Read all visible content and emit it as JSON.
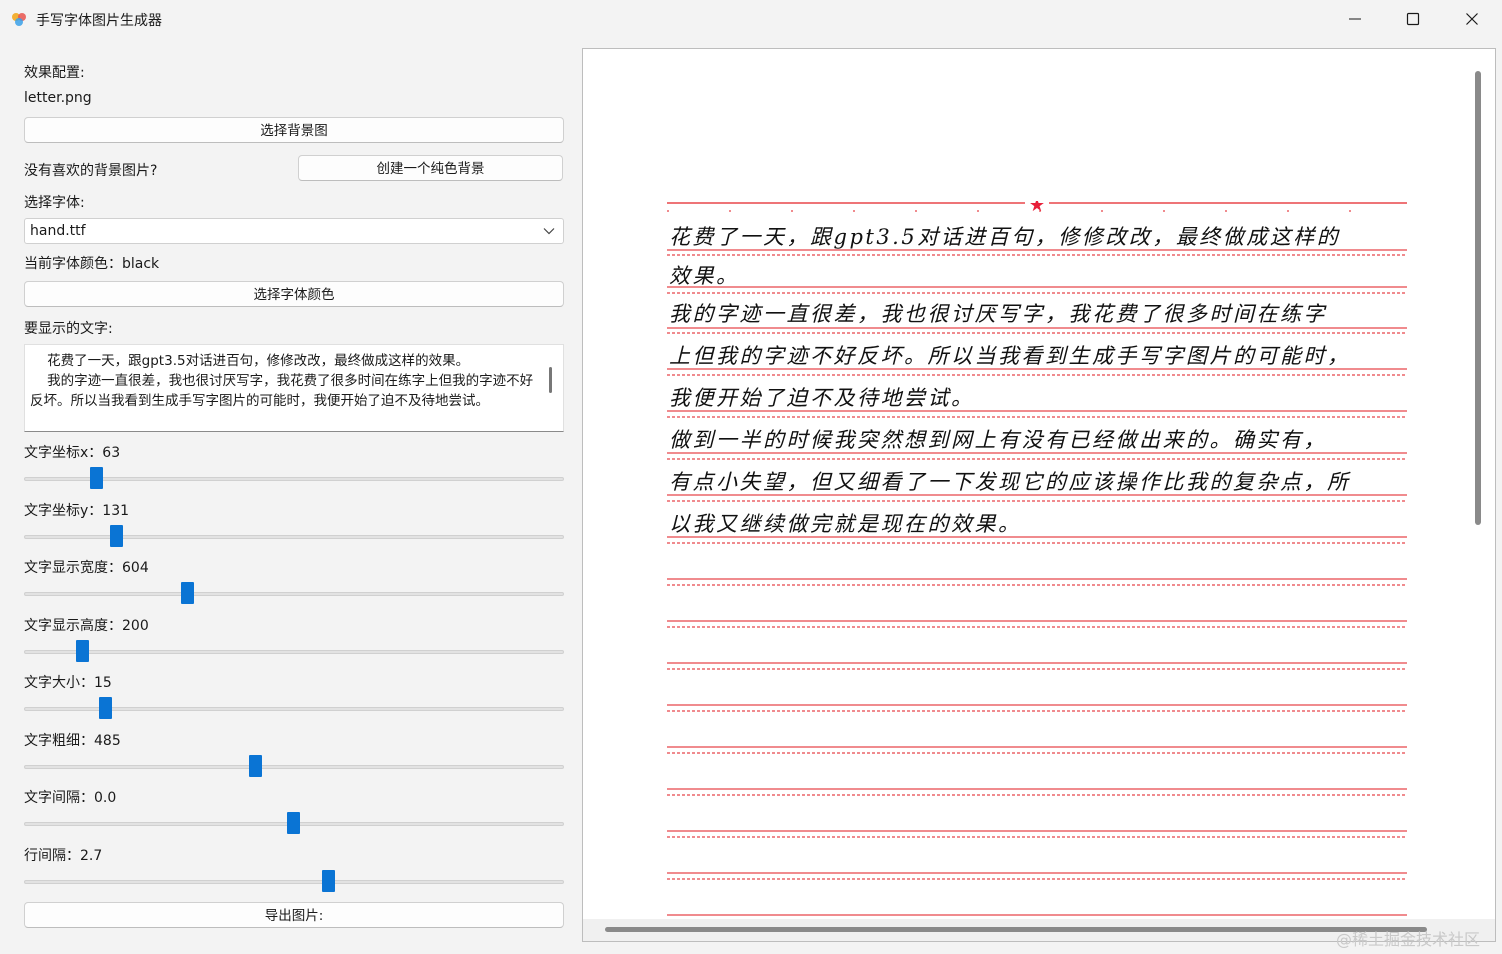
{
  "window": {
    "title": "手写字体图片生成器",
    "icon": "app-color-icon",
    "controls": [
      "minimize-icon",
      "maximize-icon",
      "close-icon"
    ]
  },
  "config": {
    "effect_label": "效果配置:",
    "background_file": "letter.png",
    "choose_background_button": "选择背景图",
    "no_favorite_label": "没有喜欢的背景图片?",
    "create_solid_button": "创建一个纯色背景",
    "choose_font_label": "选择字体:",
    "font_selected": "hand.ttf",
    "font_color_label": "当前字体颜色：black",
    "choose_font_color_button": "选择字体颜色",
    "text_label": "要显示的文字:",
    "text_value": "    花费了一天，跟gpt3.5对话进百句，修修改改，最终做成这样的效果。\n    我的字迹一直很差，我也很讨厌写字，我花费了很多时间在练字上但我的字迹不好反坏。所以当我看到生成手写字图片的可能时，我便开始了迫不及待地尝试。",
    "export_button": "导出图片:"
  },
  "sliders": [
    {
      "label": "文字坐标x：63",
      "value": 0.14
    },
    {
      "label": "文字坐标y：131",
      "value": 0.18
    },
    {
      "label": "文字显示宽度：604",
      "value": 0.3
    },
    {
      "label": "文字显示高度：200",
      "value": 0.11
    },
    {
      "label": "文字大小：15",
      "value": 0.16
    },
    {
      "label": "文字粗细：485",
      "value": 0.43
    },
    {
      "label": "文字间隔：0.0",
      "value": 0.5
    },
    {
      "label": "行间隔：2.7",
      "value": 0.56
    }
  ],
  "preview": {
    "star": "★",
    "lines": [
      "   花费了一天，跟gpt3.5对话进百句，修修改改，最终做成这样的",
      "效果。",
      "   我的字迹一直很差，我也很讨厌写字，我花费了很多时间在练字",
      "上但我的字迹不好反坏。所以当我看到生成手写字图片的可能时，",
      "我便开始了迫不及待地尝试。",
      "   做到一半的时候我突然想到网上有没有已经做出来的。确实有，",
      "有点小失望，但又细看了一下发现它的应该操作比我的复杂点，所",
      "以我又继续做完就是现在的效果。"
    ]
  },
  "watermark": "@稀土掘金技术社区",
  "colors": {
    "accent": "#0a74d4",
    "ruled_line": "#e8464a",
    "background": "#f3f3f3"
  }
}
